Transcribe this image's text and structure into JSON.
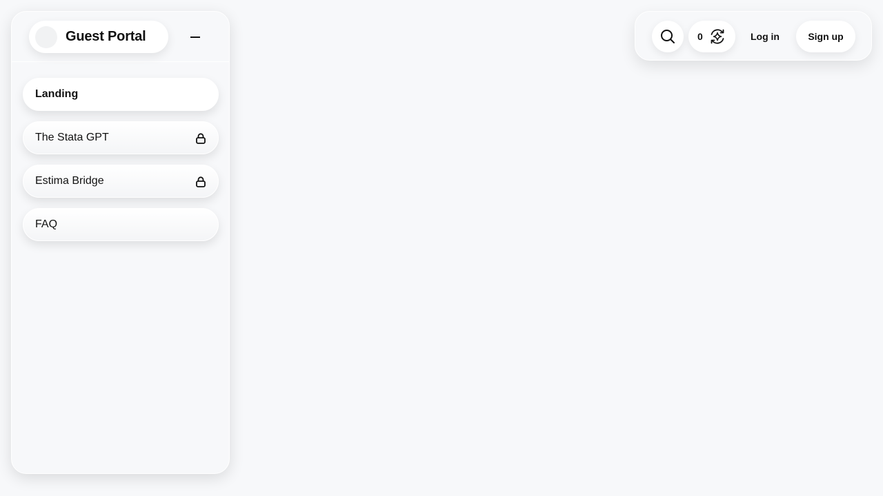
{
  "sidebar": {
    "brand": {
      "title": "Guest Portal",
      "avatar_color": "#f1f2f3"
    },
    "collapse_icon": "minus-icon",
    "items": [
      {
        "label": "Landing",
        "active": true,
        "locked": false
      },
      {
        "label": "The Stata GPT",
        "active": false,
        "locked": true,
        "icon": "lock-icon"
      },
      {
        "label": "Estima Bridge",
        "active": false,
        "locked": true,
        "icon": "lock-icon"
      },
      {
        "label": "FAQ",
        "active": false,
        "locked": false
      }
    ]
  },
  "toolbar": {
    "search_icon": "search-icon",
    "credits": {
      "count": "0",
      "icon": "sparkle-refresh-icon"
    },
    "login_label": "Log in",
    "signup_label": "Sign up"
  },
  "colors": {
    "background": "#f7f8fa",
    "surface": "#ffffff",
    "text": "#111111"
  }
}
